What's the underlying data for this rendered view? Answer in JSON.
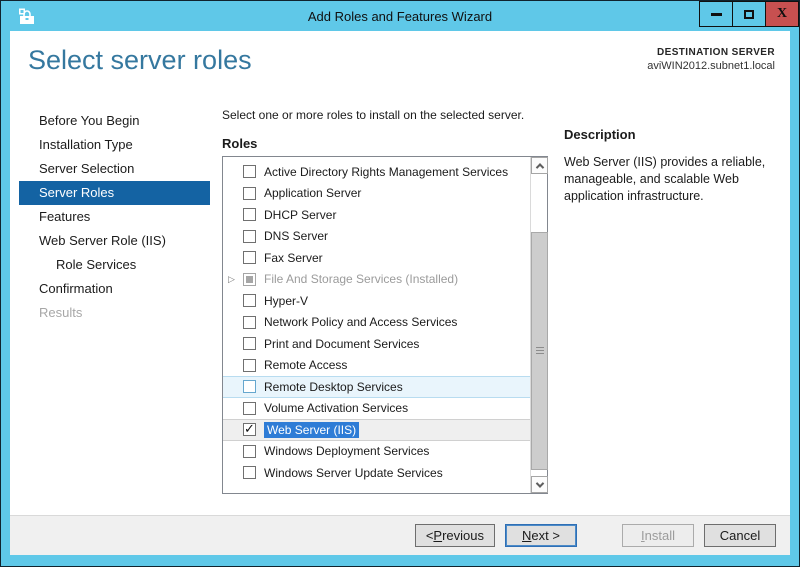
{
  "window": {
    "title": "Add Roles and Features Wizard",
    "icons": {
      "app": "toolbox",
      "minimize": "minus-bar",
      "maximize": "square-outline",
      "close": "X",
      "expander": "▷",
      "check": "✓"
    }
  },
  "header": {
    "title": "Select server roles",
    "destination_label": "DESTINATION SERVER",
    "destination_server": "aviWIN2012.subnet1.local"
  },
  "sidebar": {
    "items": [
      {
        "label": "Before You Begin",
        "state": "normal"
      },
      {
        "label": "Installation Type",
        "state": "normal"
      },
      {
        "label": "Server Selection",
        "state": "normal"
      },
      {
        "label": "Server Roles",
        "state": "selected"
      },
      {
        "label": "Features",
        "state": "normal"
      },
      {
        "label": "Web Server Role (IIS)",
        "state": "normal"
      },
      {
        "label": "Role Services",
        "state": "normal",
        "indent": true
      },
      {
        "label": "Confirmation",
        "state": "normal"
      },
      {
        "label": "Results",
        "state": "disabled"
      }
    ]
  },
  "main": {
    "instruction": "Select one or more roles to install on the selected server.",
    "roles_label": "Roles",
    "roles": [
      {
        "label": "Active Directory Rights Management Services",
        "checkbox": "unchecked",
        "state": "normal"
      },
      {
        "label": "Application Server",
        "checkbox": "unchecked",
        "state": "normal"
      },
      {
        "label": "DHCP Server",
        "checkbox": "unchecked",
        "state": "normal"
      },
      {
        "label": "DNS Server",
        "checkbox": "unchecked",
        "state": "normal"
      },
      {
        "label": "Fax Server",
        "checkbox": "unchecked",
        "state": "normal"
      },
      {
        "label": "File And Storage Services (Installed)",
        "checkbox": "indeterminate",
        "state": "installed",
        "expandable": true
      },
      {
        "label": "Hyper-V",
        "checkbox": "unchecked",
        "state": "normal"
      },
      {
        "label": "Network Policy and Access Services",
        "checkbox": "unchecked",
        "state": "normal"
      },
      {
        "label": "Print and Document Services",
        "checkbox": "unchecked",
        "state": "normal"
      },
      {
        "label": "Remote Access",
        "checkbox": "unchecked",
        "state": "normal"
      },
      {
        "label": "Remote Desktop Services",
        "checkbox": "unchecked",
        "state": "hover"
      },
      {
        "label": "Volume Activation Services",
        "checkbox": "unchecked",
        "state": "normal"
      },
      {
        "label": "Web Server (IIS)",
        "checkbox": "checked",
        "state": "selected"
      },
      {
        "label": "Windows Deployment Services",
        "checkbox": "unchecked",
        "state": "normal"
      },
      {
        "label": "Windows Server Update Services",
        "checkbox": "unchecked",
        "state": "normal"
      }
    ]
  },
  "description": {
    "heading": "Description",
    "text": "Web Server (IIS) provides a reliable, manageable, and scalable Web application infrastructure."
  },
  "footer": {
    "buttons": [
      {
        "name": "previous-button",
        "pre": "< ",
        "key": "P",
        "post": "revious",
        "enabled": true,
        "default": false
      },
      {
        "name": "next-button",
        "pre": "",
        "key": "N",
        "post": "ext >",
        "enabled": true,
        "default": true
      },
      {
        "name": "install-button",
        "pre": "",
        "key": "I",
        "post": "nstall",
        "enabled": false,
        "default": false
      },
      {
        "name": "cancel-button",
        "pre": "",
        "key": "",
        "post": "Cancel",
        "enabled": true,
        "default": false
      }
    ]
  },
  "colors": {
    "titlebar": "#5FC8E8",
    "close_button": "#C75050",
    "heading": "#35789F",
    "nav_selected_bg": "#1463A3",
    "selection_highlight": "#2E7CD6",
    "hover_row_bg": "#E9F5FC",
    "footer_bg": "#F0F0F0"
  }
}
